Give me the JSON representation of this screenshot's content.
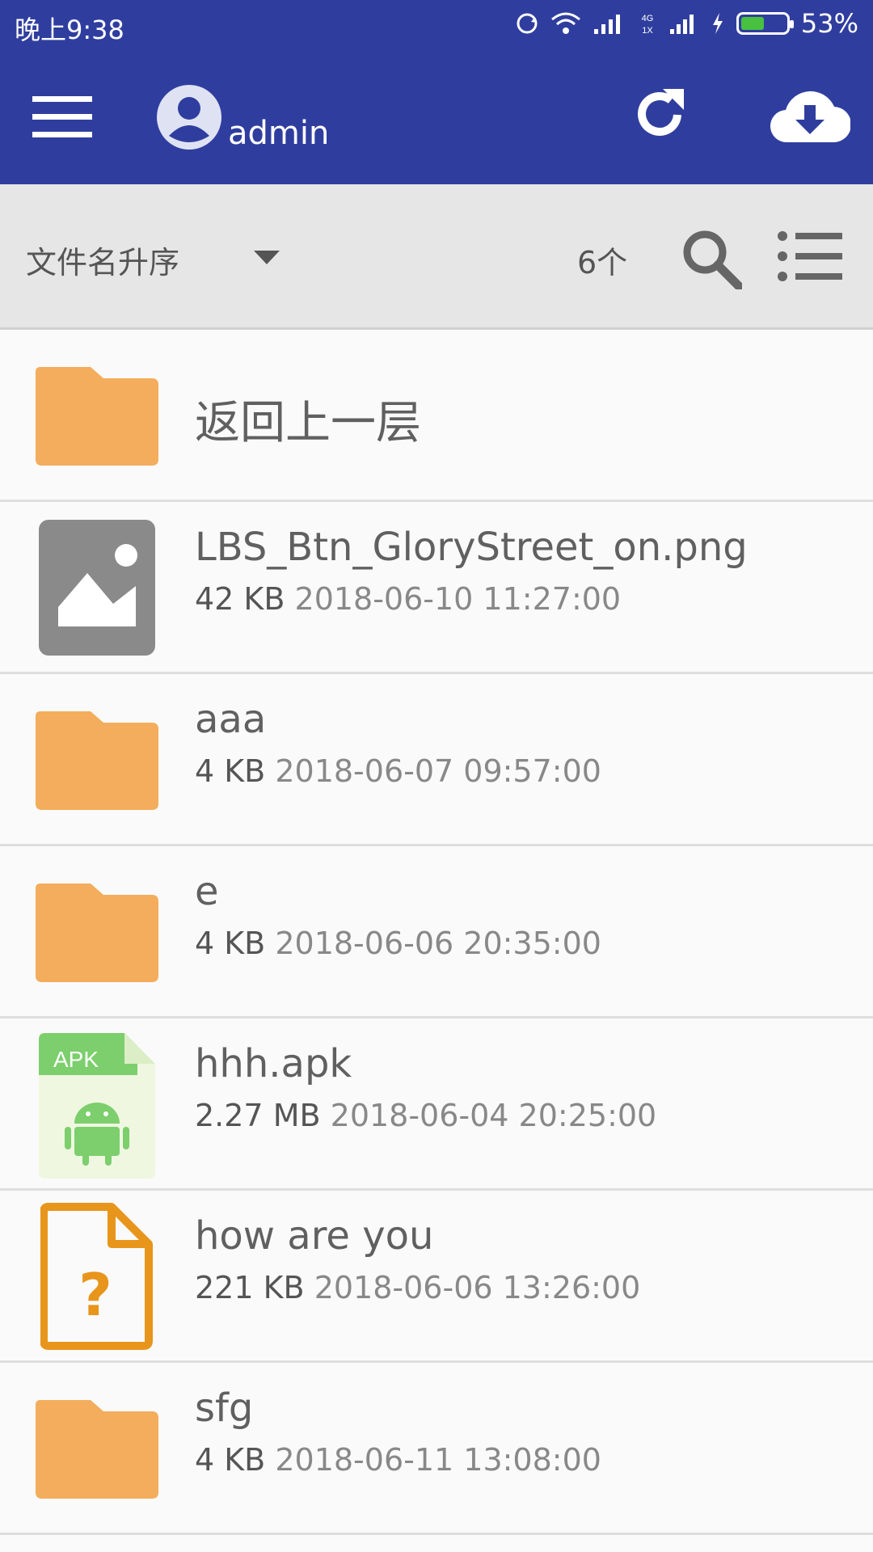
{
  "status_bar": {
    "time": "晚上9:38",
    "network": "4G\n1X",
    "battery": "53%"
  },
  "app_bar": {
    "username": "admin"
  },
  "toolbar": {
    "sort_label": "文件名升序",
    "count": "6个"
  },
  "parent_row": {
    "label": "返回上一层"
  },
  "files": [
    {
      "name": "LBS_Btn_GloryStreet_on.png",
      "size": "42 KB",
      "date": "2018-06-10 11:27:00",
      "icon": "image-file-icon"
    },
    {
      "name": "aaa",
      "size": "4 KB",
      "date": "2018-06-07 09:57:00",
      "icon": "folder-icon"
    },
    {
      "name": "e",
      "size": "4 KB",
      "date": "2018-06-06 20:35:00",
      "icon": "folder-icon"
    },
    {
      "name": "hhh.apk",
      "size": "2.27 MB",
      "date": "2018-06-04 20:25:00",
      "icon": "apk-file-icon",
      "icon_text": "APK"
    },
    {
      "name": "how are you",
      "size": "221 KB",
      "date": "2018-06-06 13:26:00",
      "icon": "unknown-file-icon"
    },
    {
      "name": "sfg",
      "size": "4 KB",
      "date": "2018-06-11 13:08:00",
      "icon": "folder-icon"
    }
  ],
  "colors": {
    "primary": "#2f3e9e",
    "folder": "#f3ad5c",
    "apk_green": "#7ccf6c",
    "unknown_orange": "#e8951c"
  }
}
